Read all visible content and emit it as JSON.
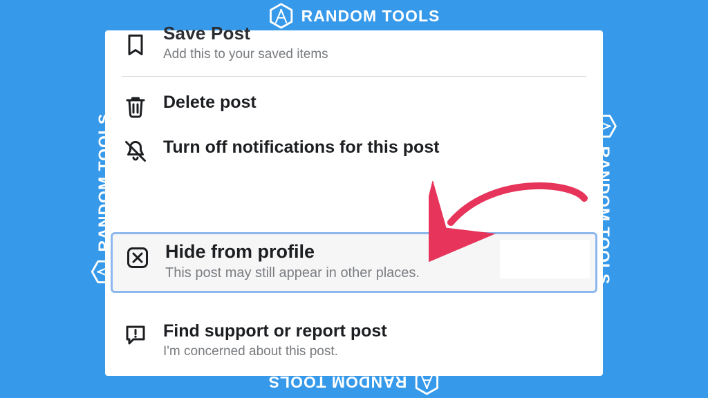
{
  "brand": {
    "name": "RANDOM TOOLS"
  },
  "colors": {
    "bg": "#3699e9",
    "highlight_border": "#8db8ed",
    "arrow": "#e6345b"
  },
  "menu": {
    "save": {
      "icon": "bookmark-icon",
      "title": "Save Post",
      "sub": "Add this to your saved items"
    },
    "delete": {
      "icon": "trash-icon",
      "title": "Delete post"
    },
    "notify_off": {
      "icon": "bell-slash-icon",
      "title": "Turn off notifications for this post"
    },
    "hide": {
      "icon": "x-box-icon",
      "title": "Hide from profile",
      "sub": "This post may still appear in other places."
    },
    "report": {
      "icon": "report-icon",
      "title": "Find support or report post",
      "sub": "I'm concerned about this post."
    }
  }
}
